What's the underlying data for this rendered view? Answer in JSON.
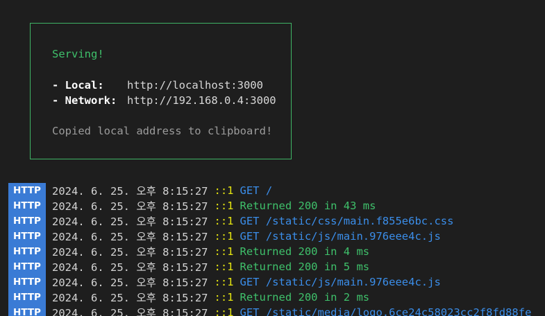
{
  "serve_box": {
    "status": "Serving!",
    "local_label": "- Local:",
    "local_url": "http://localhost:3000",
    "network_label": "- Network:",
    "network_url": "http://192.168.0.4:3000",
    "copied_note": "Copied local address to clipboard!"
  },
  "colors": {
    "background": "#1e1e1e",
    "box_border": "#3fb566",
    "badge": "#3a7bd5",
    "get": "#3b8eea",
    "returned": "#3fc16b",
    "ip": "#e5e510"
  },
  "log": [
    {
      "badge": "HTTP",
      "timestamp": "2024. 6. 25. 오후 8:15:27",
      "ip": "::1",
      "kind": "get",
      "message": "GET /"
    },
    {
      "badge": "HTTP",
      "timestamp": "2024. 6. 25. 오후 8:15:27",
      "ip": "::1",
      "kind": "ret",
      "message": "Returned 200 in 43 ms"
    },
    {
      "badge": "HTTP",
      "timestamp": "2024. 6. 25. 오후 8:15:27",
      "ip": "::1",
      "kind": "get",
      "message": "GET /static/css/main.f855e6bc.css"
    },
    {
      "badge": "HTTP",
      "timestamp": "2024. 6. 25. 오후 8:15:27",
      "ip": "::1",
      "kind": "get",
      "message": "GET /static/js/main.976eee4c.js"
    },
    {
      "badge": "HTTP",
      "timestamp": "2024. 6. 25. 오후 8:15:27",
      "ip": "::1",
      "kind": "ret",
      "message": "Returned 200 in 4 ms"
    },
    {
      "badge": "HTTP",
      "timestamp": "2024. 6. 25. 오후 8:15:27",
      "ip": "::1",
      "kind": "ret",
      "message": "Returned 200 in 5 ms"
    },
    {
      "badge": "HTTP",
      "timestamp": "2024. 6. 25. 오후 8:15:27",
      "ip": "::1",
      "kind": "get",
      "message": "GET /static/js/main.976eee4c.js"
    },
    {
      "badge": "HTTP",
      "timestamp": "2024. 6. 25. 오후 8:15:27",
      "ip": "::1",
      "kind": "ret",
      "message": "Returned 200 in 2 ms"
    },
    {
      "badge": "HTTP",
      "timestamp": "2024. 6. 25. 오후 8:15:27",
      "ip": "::1",
      "kind": "get",
      "message": "GET /static/media/logo.6ce24c58023cc2f8fd88fe"
    }
  ]
}
